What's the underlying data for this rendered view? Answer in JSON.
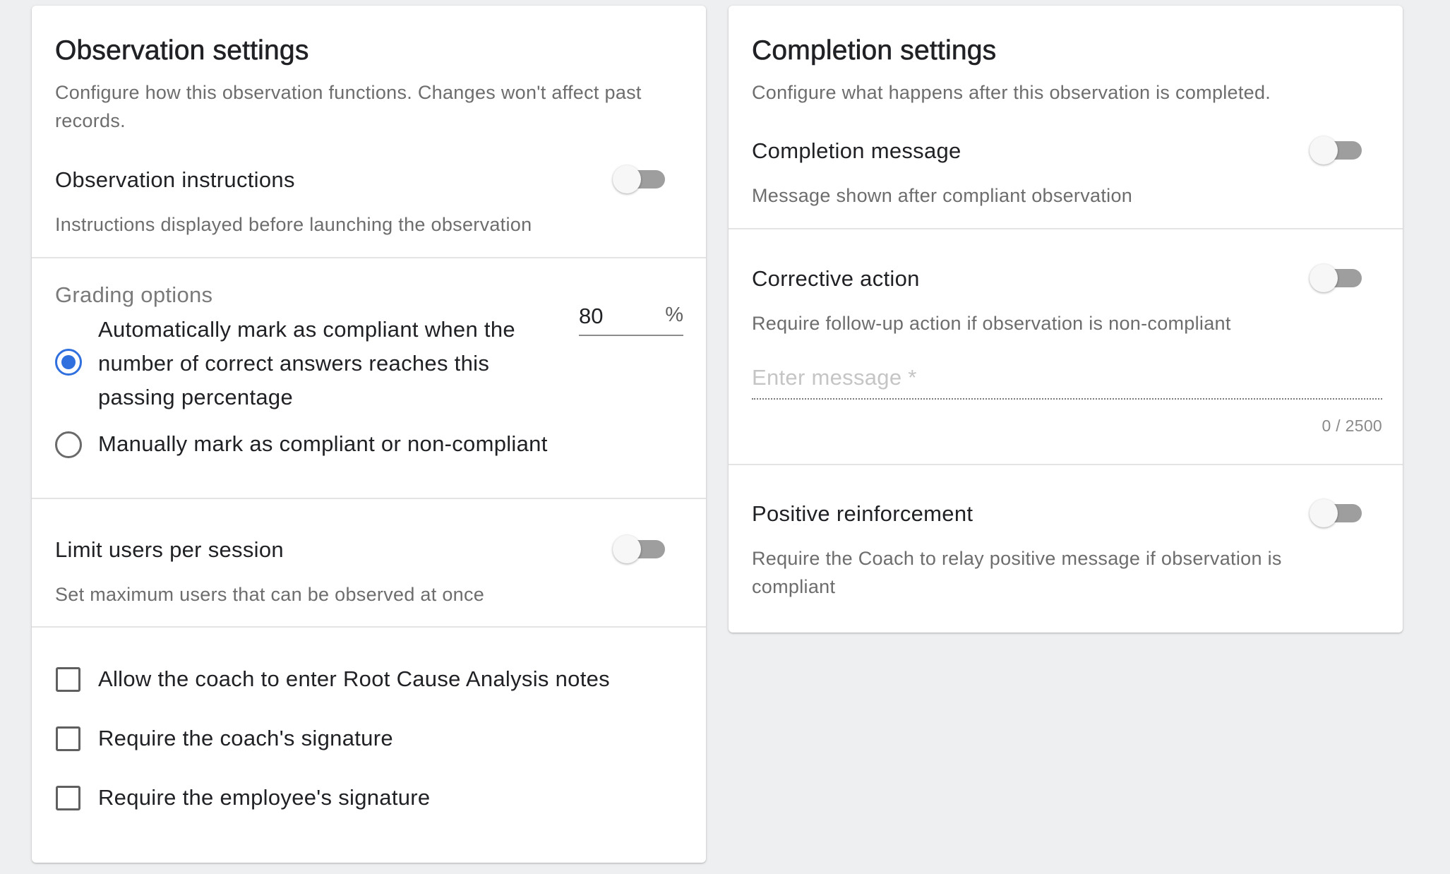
{
  "observation_settings": {
    "title": "Observation settings",
    "subtitle": "Configure how this observation functions. Changes won't affect past records.",
    "instructions": {
      "label": "Observation instructions",
      "description": "Instructions displayed before launching the observation",
      "enabled": false
    },
    "grading": {
      "label": "Grading options",
      "auto_option_label": "Automatically mark as compliant when the number of correct answers reaches this passing percentage",
      "manual_option_label": "Manually mark as compliant or non-compliant",
      "selected": "auto",
      "passing_percentage": "80",
      "percent_suffix": "%"
    },
    "limit_users": {
      "label": "Limit users per session",
      "description": "Set maximum users that can be observed at once",
      "enabled": false
    },
    "checkboxes": [
      {
        "label": "Allow the coach to enter Root Cause Analysis notes",
        "checked": false
      },
      {
        "label": "Require the coach's signature",
        "checked": false
      },
      {
        "label": "Require the employee's signature",
        "checked": false
      }
    ]
  },
  "completion_settings": {
    "title": "Completion settings",
    "subtitle": "Configure what happens after this observation is completed.",
    "completion_message": {
      "label": "Completion message",
      "description": "Message shown after compliant observation",
      "enabled": false
    },
    "corrective_action": {
      "label": "Corrective action",
      "description": "Require follow-up action if observation is non-compliant",
      "enabled": false,
      "message_placeholder": "Enter message *",
      "message_value": "",
      "char_counter": "0 / 2500"
    },
    "positive_reinforcement": {
      "label": "Positive reinforcement",
      "description": "Require the Coach to relay positive message if observation is compliant",
      "enabled": false
    }
  },
  "colors": {
    "page_background": "#eeeff1",
    "card_background": "#ffffff",
    "accent": "#2f6fde",
    "toggle_off_track": "#9e9e9e",
    "secondary_text": "#6d6d6d"
  }
}
